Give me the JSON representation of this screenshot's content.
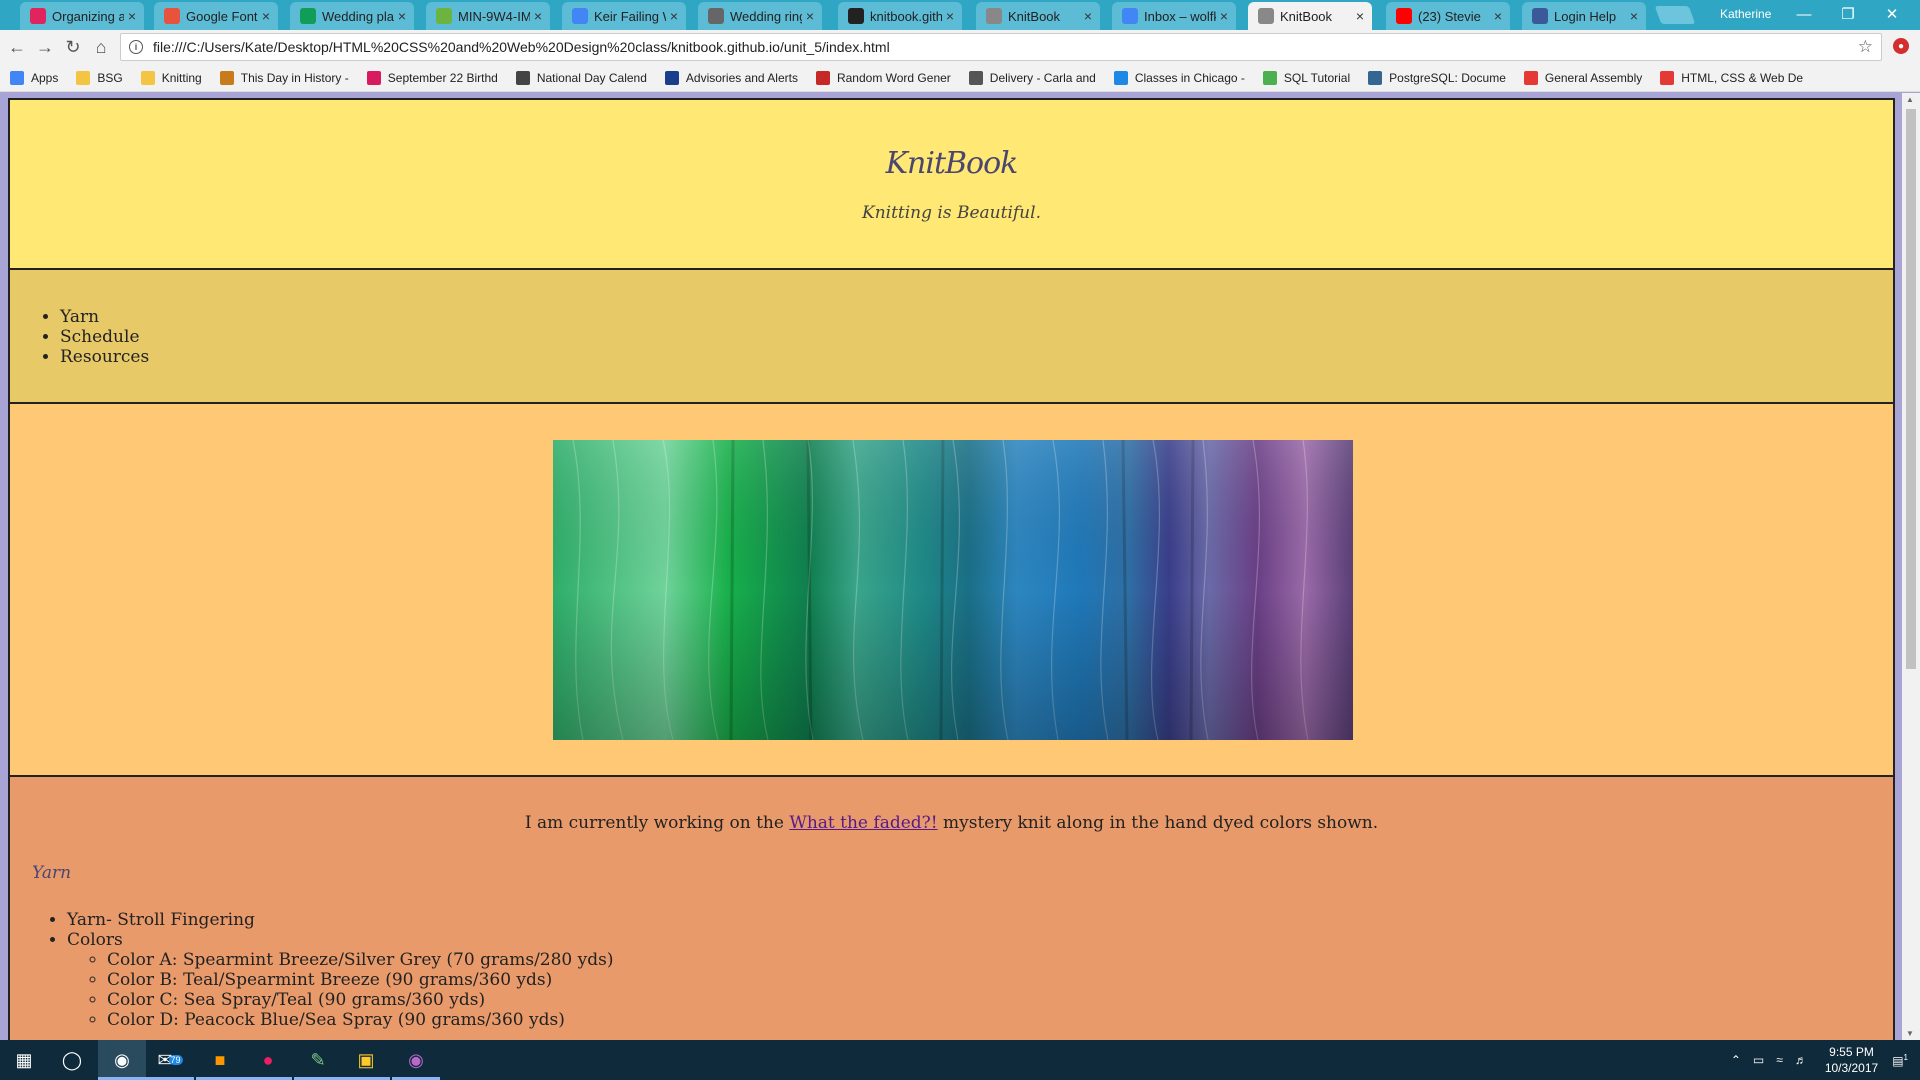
{
  "browser": {
    "tabs": [
      {
        "label": "Organizing an",
        "favicon": "ga-icon",
        "color": "#e0245e"
      },
      {
        "label": "Google Fonts",
        "favicon": "google-fonts-icon",
        "color": "#e8533d"
      },
      {
        "label": "Wedding plan",
        "favicon": "sheets-icon",
        "color": "#0f9d58"
      },
      {
        "label": "MIN-9W4-IM",
        "favicon": "m-icon",
        "color": "#6db33f"
      },
      {
        "label": "Keir Failing W",
        "favicon": "docs-icon",
        "color": "#4285f4"
      },
      {
        "label": "Wedding ring",
        "favicon": "wikipedia-icon",
        "color": "#666666"
      },
      {
        "label": "knitbook.githu",
        "favicon": "github-icon",
        "color": "#222222"
      },
      {
        "label": "KnitBook",
        "favicon": "page-icon",
        "color": "#888888"
      },
      {
        "label": "Inbox – wolfk",
        "favicon": "inbox-icon",
        "color": "#4285f4"
      },
      {
        "label": "KnitBook",
        "favicon": "page-icon",
        "color": "#888888",
        "active": true
      },
      {
        "label": "(23) Stevie",
        "favicon": "youtube-icon",
        "color": "#ff0000"
      },
      {
        "label": "Login Help",
        "favicon": "facebook-icon",
        "color": "#3b5998"
      }
    ],
    "profile": "Katherine",
    "url": "file:///C:/Users/Kate/Desktop/HTML%20CSS%20and%20Web%20Design%20class/knitbook.github.io/unit_5/index.html",
    "bookmarks": [
      {
        "label": "Apps",
        "icon": "apps-grid-icon",
        "color": "#4285f4"
      },
      {
        "label": "BSG",
        "icon": "folder-icon",
        "color": "#f4c542"
      },
      {
        "label": "Knitting",
        "icon": "folder-icon",
        "color": "#f4c542"
      },
      {
        "label": "This Day in History -",
        "icon": "history-icon",
        "color": "#c77b1b"
      },
      {
        "label": "September 22 Birthd",
        "icon": "star-icon",
        "color": "#d81b60"
      },
      {
        "label": "National Day Calend",
        "icon": "calendar-icon",
        "color": "#444444"
      },
      {
        "label": "Advisories and Alerts",
        "icon": "m-icon",
        "color": "#1a3e8c"
      },
      {
        "label": "Random Word Gener",
        "icon": "generator-icon",
        "color": "#c62828"
      },
      {
        "label": "Delivery - Carla and",
        "icon": "delivery-icon",
        "color": "#555555"
      },
      {
        "label": "Classes in Chicago -",
        "icon": "classes-icon",
        "color": "#1e88e5"
      },
      {
        "label": "SQL Tutorial",
        "icon": "w3schools-icon",
        "color": "#4caf50"
      },
      {
        "label": "PostgreSQL: Docume",
        "icon": "postgres-icon",
        "color": "#336791"
      },
      {
        "label": "General Assembly",
        "icon": "ga-icon",
        "color": "#e53935"
      },
      {
        "label": "HTML, CSS & Web De",
        "icon": "ga-icon",
        "color": "#e53935"
      }
    ]
  },
  "site": {
    "title": "KnitBook",
    "tagline": "Knitting is Beautiful.",
    "nav": [
      "Yarn",
      "Schedule",
      "Resources"
    ],
    "intro_before": "I am currently working on the ",
    "intro_link": "What the faded?!",
    "intro_after": " mystery knit along in the hand dyed colors shown.",
    "yarn_heading": "Yarn",
    "details": {
      "yarn": "Yarn- Stroll Fingering",
      "colors_label": "Colors",
      "colors": [
        "Color A: Spearmint Breeze/Silver Grey (70 grams/280 yds)",
        "Color B: Teal/Spearmint Breeze (90 grams/360 yds)",
        "Color C: Sea Spray/Teal (90 grams/360 yds)",
        "Color D: Peacock Blue/Sea Spray (90 grams/360 yds)"
      ]
    }
  },
  "taskbar": {
    "mail_badge": "79",
    "time": "9:55 PM",
    "date": "10/3/2017",
    "notifications": "1"
  }
}
